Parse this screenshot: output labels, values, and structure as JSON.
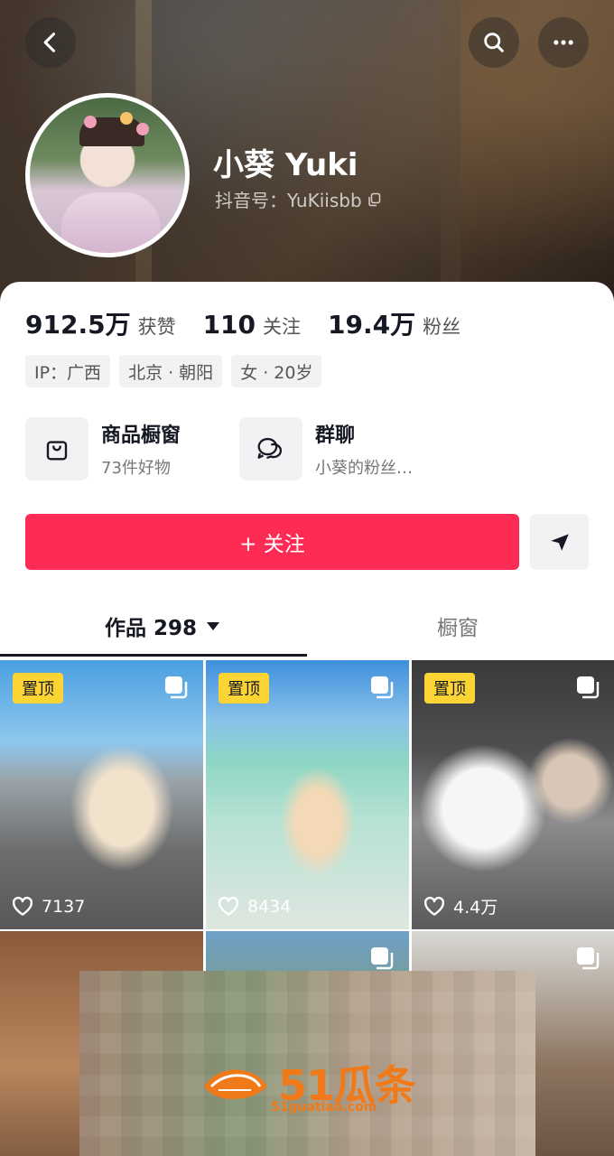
{
  "profile": {
    "name": "小葵 Yuki",
    "douyin_id": "抖音号：YuKiisbb"
  },
  "stats": [
    {
      "num": "912.5万",
      "label": "获赞"
    },
    {
      "num": "110",
      "label": "关注"
    },
    {
      "num": "19.4万",
      "label": "粉丝"
    }
  ],
  "tags": [
    "IP：广西",
    "北京 · 朝阳",
    "女 · 20岁"
  ],
  "features": [
    {
      "title": "商品橱窗",
      "sub": "73件好物",
      "icon": "shopping-bag-icon"
    },
    {
      "title": "群聊",
      "sub": "小葵的粉丝…",
      "icon": "chat-bubbles-icon"
    }
  ],
  "actions": {
    "follow_label": "+ 关注"
  },
  "tabs": {
    "works_label": "作品 298",
    "window_label": "橱窗"
  },
  "grid": {
    "pin_label": "置顶",
    "tiles": [
      {
        "likes": "7137",
        "pinned": true
      },
      {
        "likes": "8434",
        "pinned": true
      },
      {
        "likes": "4.4万",
        "pinned": true
      },
      {
        "likes": "",
        "pinned": false
      },
      {
        "likes": "",
        "pinned": false
      },
      {
        "likes": "",
        "pinned": false
      }
    ]
  },
  "watermark": {
    "brand": "51瓜条",
    "url": "51guatiao.com"
  },
  "colors": {
    "accent": "#fe2c55",
    "pin": "#fcd535"
  }
}
